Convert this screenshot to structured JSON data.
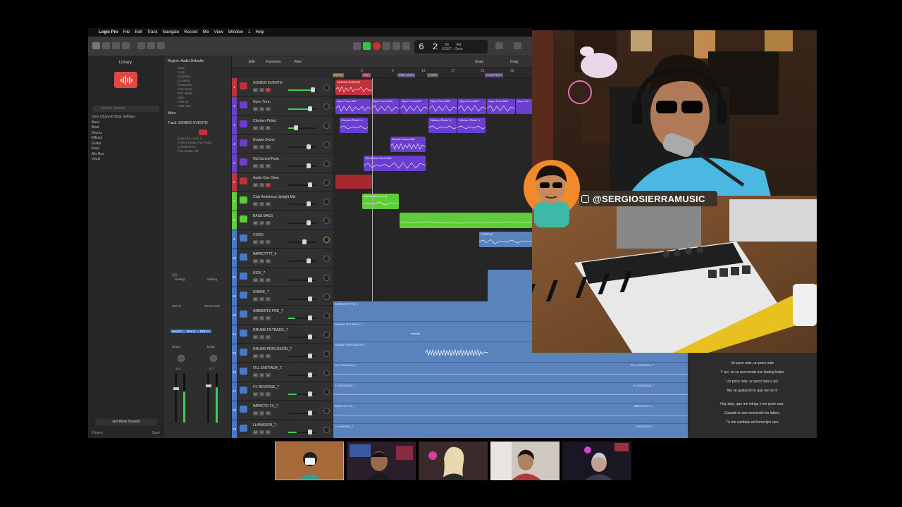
{
  "menubar": {
    "items": [
      "Logic Pro",
      "File",
      "Edit",
      "Track",
      "Navigate",
      "Record",
      "Mix",
      "View",
      "Window",
      "1",
      "Help"
    ]
  },
  "lcd": {
    "position": "6 2",
    "tempo": "96",
    "tempo_label": "KEEP",
    "signature": "4/4",
    "key": "Gmin"
  },
  "library": {
    "title": "Library",
    "search_placeholder": "Search Sounds",
    "items": [
      "User Channel Strip Settings",
      "Bass",
      "Beat",
      "Drums",
      "Effects",
      "Guitar",
      "Keys",
      "Mix Bus",
      "Vocal"
    ],
    "footer_button": "Get More Sounds",
    "footer_left": "Revert",
    "footer_right": "Save"
  },
  "inspector": {
    "region_header": "Region: Audio Defaults",
    "region_params": [
      "Mute",
      "Loop",
      "Quantize",
      "Q-Swing",
      "Transpose",
      "Fine Tune",
      "Flex Mode",
      "Gain",
      "Fade In",
      "Fade Out"
    ],
    "more_label": "More",
    "track_header": "Track: SONIDO EVENTO",
    "track_params": [
      "Icon",
      "Channel: Audio 1",
      "Freeze Mode: Pre Fader",
      "Q-Reference",
      "Flex Mode: Off"
    ],
    "strip_labels": {
      "a_setting": "Setting",
      "b_setting": "Setting",
      "a_name": "INPUT",
      "b_name": "Stereo Out",
      "send": "Send 2 → Bus 6 → DELAY",
      "a_read": "Read",
      "b_read": "Read",
      "a_val": "-1.5",
      "b_val": "-0.7"
    }
  },
  "tracks_header": {
    "edit": "Edit",
    "functions": "Functions",
    "view": "View",
    "snap": "Snap:",
    "drag": "Drag:"
  },
  "ruler": {
    "bars": [
      "5",
      "9",
      "13",
      "17",
      "21",
      "25"
    ],
    "markers": [
      "INTRO",
      "PUL",
      "PRE CORO",
      "CORO",
      "CUARTETO"
    ]
  },
  "tracks": [
    {
      "num": "1",
      "name": "SONIDO EVENTO",
      "color": "#c0323c"
    },
    {
      "num": "2",
      "name": "Gyno Trem",
      "color": "#6a3fd0"
    },
    {
      "num": "3",
      "name": "Chicken Pickin'",
      "color": "#6a3fd0"
    },
    {
      "num": "4",
      "name": "Double Drone",
      "color": "#6a3fd0"
    },
    {
      "num": "5",
      "name": "Old School Funk",
      "color": "#6a3fd0"
    },
    {
      "num": "6",
      "name": "Audio Ops Clear",
      "color": "#c0323c"
    },
    {
      "num": "7",
      "name": "Club Ambience Upright Mix",
      "color": "#5fcc3a"
    },
    {
      "num": "8",
      "name": "BASS BASS",
      "color": "#5fcc3a"
    },
    {
      "num": "9",
      "name": "CORO",
      "color": "#4a78c8"
    },
    {
      "num": "10",
      "name": "IMPACTTTT_9",
      "color": "#4a78c8"
    },
    {
      "num": "11",
      "name": "KICK_7",
      "color": "#4a78c8"
    },
    {
      "num": "12",
      "name": "SNARE_7",
      "color": "#4a78c8"
    },
    {
      "num": "13",
      "name": "AMBIENTE PRE_7",
      "color": "#4a78c8"
    },
    {
      "num": "14",
      "name": "DRUMS FILTRADO_7",
      "color": "#4a78c8"
    },
    {
      "num": "15",
      "name": "DRUMS PERCUSIÓN_7",
      "color": "#4a78c8"
    },
    {
      "num": "16",
      "name": "FILL ENTRADA_7",
      "color": "#4a78c8"
    },
    {
      "num": "17",
      "name": "FX REVERSE_7",
      "color": "#4a78c8"
    },
    {
      "num": "18",
      "name": "IMPACTO FX_7",
      "color": "#4a78c8"
    },
    {
      "num": "19",
      "name": "LLAMADOR_7",
      "color": "#4a78c8"
    }
  ],
  "regions": {
    "r1": "SONIDO EVENTO",
    "gyno": [
      "Gyno Trem #52",
      "Gyno Trem #53",
      "Gyno Trem #53",
      "Gyno Trem #56",
      "Gyno Trem #57",
      "Gyno Trem #58",
      "Gyno Tre"
    ],
    "chicken": [
      "Chicken Pickin' #",
      "Chicken Pickin' #",
      "Chicken Pickin' #"
    ],
    "double": "Double Drone #96",
    "oldschool": "Old School Funk #96",
    "club": "Club Ambience Up",
    "coro": "CORO #2"
  },
  "band_rows": [
    {
      "left": "AMBIENTE PRE_7",
      "right": ""
    },
    {
      "left": "DRUMS FILTRADO_7",
      "right": ""
    },
    {
      "left": "DRUMS PERCUSIÓN_7",
      "right": ""
    },
    {
      "left": "FILL ENTRADA_7",
      "right": "FILL ENTRADA_7"
    },
    {
      "left": "FX REVERSE_7",
      "right": "FX REVERSE_7"
    },
    {
      "left": "IMPACTO FX_7",
      "right": "IMPACTO FX_7"
    },
    {
      "left": "LLAMADOR_7",
      "right": "LLAMADOR_7"
    }
  ],
  "lyrics": [
    "Un poco más, un poco más",
    "Y así, se va acercando ese feeling bailar",
    "Un poco más, un poco más y así",
    "Me ve gustando lo que veo en ti",
    "",
    "Hay algo, que me intriga y me pone raro,",
    "Cuando te veo moviendo los labios,",
    "Tú me cambias mi forma tipo raro"
  ],
  "webcam": {
    "handle": "@SERGIOSIERRAMUSIC"
  },
  "colors": {
    "logic_bg": "#2b2b2b",
    "red_region": "#c0323c",
    "purple_region": "#6a3fd0",
    "green_region": "#5fcc3a",
    "blue_region": "#5a82bd",
    "accent_red": "#e04848"
  },
  "participants_count": 5
}
